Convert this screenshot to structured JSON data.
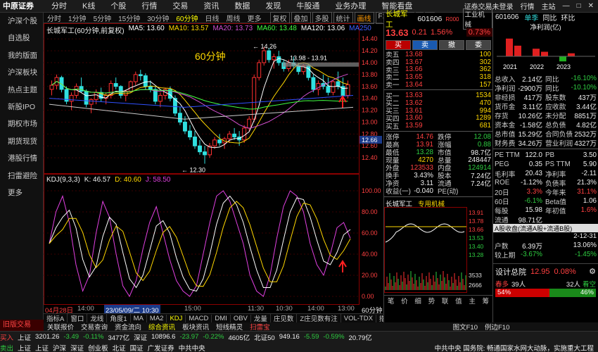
{
  "app": {
    "logo": "中原证券",
    "menu": [
      "分时",
      "K线",
      "个股",
      "行情",
      "交易",
      "资讯",
      "数据",
      "发现",
      "牛股通",
      "业务办理",
      "智能看盘"
    ],
    "topright": [
      "证券交易未登录",
      "行情",
      "主站"
    ],
    "winbtns": [
      "—",
      "□",
      "✕"
    ]
  },
  "sidebar": {
    "items": [
      "沪深个股",
      "自选股",
      "我的版面",
      "沪深板块",
      "热点主题",
      "新股IPO",
      "期权市场",
      "期货现货",
      "港股行情",
      "扫雷避险",
      "更多"
    ],
    "old_trade": "旧版交易"
  },
  "chart_toolbar": {
    "items": [
      "分时",
      "1分钟",
      "5分钟",
      "15分钟",
      "30分钟",
      "60分钟",
      "日线",
      "周线",
      "更多"
    ],
    "active": "60分钟",
    "right_items": [
      "复权",
      "叠加",
      "多股",
      "统计",
      "画线",
      "F10",
      "标记",
      "-",
      "+"
    ]
  },
  "price_chart": {
    "header": "长城军工(60分钟,前复权)",
    "ma": [
      {
        "label": "MA5: 13.60",
        "color": "#ffffff"
      },
      {
        "label": "MA10: 13.57",
        "color": "#ffd700"
      },
      {
        "label": "MA20: 13.73",
        "color": "#d050d0"
      },
      {
        "label": "MA60: 13.48",
        "color": "#40ff40"
      },
      {
        "label": "MA120: 13.06",
        "color": "#ffffff"
      },
      {
        "label": "MA250",
        "color": "#4060ff"
      }
    ],
    "annotation": "60分钟",
    "high_label": "14.26",
    "low_label": "12.30",
    "range_label": "13.98 - 13.91",
    "y_ticks": [
      "14.40",
      "14.20",
      "14.00",
      "13.80",
      "13.60",
      "13.40",
      "13.20",
      "13.00",
      "12.80",
      "12.60",
      "12.40"
    ],
    "last_price": "12.66"
  },
  "kdj": {
    "header": "KDJ(9,3,3)",
    "k": "K: 46.57",
    "d": "D: 40.60",
    "j": "J: 58.50",
    "y_ticks": [
      "100.00",
      "80.00",
      "60.00",
      "40.00",
      "20.00",
      "0.00"
    ]
  },
  "time_axis": {
    "start": "04月28日",
    "labels": [
      "14:00",
      "14:00",
      "15:00",
      "11:30",
      "10:30",
      "14:00",
      "13:00",
      "14:00"
    ],
    "cursor": "23/05/09/二 10:30",
    "period": "60分钟"
  },
  "indicator_tabs": [
    "指标A",
    "窗口",
    "龙线",
    "角度1",
    "MA",
    "MA2",
    "KDJ",
    "MACD",
    "DMI",
    "OBV",
    "龙量",
    "庄见数",
    "Z庄见数有注",
    "VOL-TDX",
    "指标B",
    "模板"
  ],
  "indicator_selected": "KDJ",
  "info_tabs": [
    "关联报价",
    "交易查询",
    "资金流向",
    "综合资讯",
    "板块资讯",
    "短线精灵",
    "扫雷宝"
  ],
  "info_tabs_right": [
    "图文F10",
    "例边F10"
  ],
  "quote": {
    "name": "长城军工",
    "code": "601606",
    "badge": "R000",
    "sector": "工业机械",
    "price": "13.63",
    "change": "0.21",
    "pct": "1.56%",
    "sector_pct": "0.73%",
    "buttons": [
      "买",
      "卖",
      "撤",
      "委"
    ],
    "asks": [
      {
        "label": "卖五",
        "price": "13.68",
        "vol": "100"
      },
      {
        "label": "卖四",
        "price": "13.67",
        "vol": "302"
      },
      {
        "label": "卖三",
        "price": "13.66",
        "vol": "362"
      },
      {
        "label": "卖二",
        "price": "13.65",
        "vol": "318"
      },
      {
        "label": "卖一",
        "price": "13.64",
        "vol": "157"
      }
    ],
    "bids": [
      {
        "label": "买一",
        "price": "13.63",
        "vol": "1534"
      },
      {
        "label": "买二",
        "price": "13.62",
        "vol": "470"
      },
      {
        "label": "买三",
        "price": "13.61",
        "vol": "994"
      },
      {
        "label": "买四",
        "price": "13.60",
        "vol": "1289"
      },
      {
        "label": "买五",
        "price": "13.59",
        "vol": "681"
      }
    ],
    "stats": [
      {
        "a": "涨停",
        "b": "14.76",
        "c": "跌停",
        "d": "12.08",
        "bc": "red",
        "dc": "green"
      },
      {
        "a": "最高",
        "b": "13.91",
        "c": "涨幅",
        "d": "0.88",
        "bc": "red",
        "dc": "green"
      },
      {
        "a": "最低",
        "b": "13.28",
        "c": "市值",
        "d": "98.7亿",
        "bc": "green",
        "dc": "white"
      },
      {
        "a": "现量",
        "b": "4270",
        "c": "总量",
        "d": "248447",
        "bc": "yellow",
        "dc": "white"
      },
      {
        "a": "外盘",
        "b": "123533",
        "c": "内盘",
        "d": "124914",
        "bc": "red",
        "dc": "green"
      },
      {
        "a": "换手",
        "b": "3.43%",
        "c": "股本",
        "d": "7.24亿",
        "bc": "white",
        "dc": "white"
      },
      {
        "a": "净资",
        "b": "3.11",
        "c": "流通",
        "d": "7.24亿",
        "bc": "white",
        "dc": "white"
      },
      {
        "a": "收益(一)",
        "b": "-0.040",
        "c": "PE(动)",
        "d": "",
        "bc": "white",
        "dc": "white"
      }
    ],
    "mini_title": "长城军工",
    "mini_sector": "专用机械",
    "mini_y": [
      "13.91",
      "13.78",
      "13.66",
      "13.53",
      "13.40",
      "13.28"
    ],
    "mini_vol": [
      "3533",
      "2666"
    ],
    "mini_tabs": [
      "笔",
      "价",
      "细",
      "势",
      "联",
      "值",
      "主",
      "筹"
    ]
  },
  "finance": {
    "code": "601606",
    "tabs": [
      "单季",
      "同比",
      "环比"
    ],
    "chart_title": "净利润(亿)",
    "years": [
      "2021",
      "2022",
      "2023"
    ],
    "bars": [
      {
        "year": "2021",
        "value": 2.1
      },
      {
        "year": "2022",
        "value": 0.9
      },
      {
        "year": "2023",
        "value": -0.6
      }
    ],
    "rows": [
      {
        "k": "总收入",
        "v": "2.14亿",
        "k2": "同比",
        "v2": "-16.10%",
        "vc": "white",
        "v2c": "green"
      },
      {
        "k": "净利润",
        "v": "-2900万",
        "k2": "同比",
        "v2": "-10.10%",
        "vc": "white",
        "v2c": "green"
      },
      {
        "k": "非经损",
        "v": "417万",
        "k2": "股东数",
        "v2": "437万",
        "vc": "white",
        "v2c": "white"
      },
      {
        "k": "货币金",
        "v": "3.11亿",
        "k2": "应收款",
        "v2": "3.44亿",
        "vc": "white",
        "v2c": "white"
      },
      {
        "k": "存货",
        "v": "10.26亿",
        "k2": "未分配",
        "v2": "8851万",
        "vc": "white",
        "v2c": "white"
      },
      {
        "k": "资本金",
        "v": "-1.58亿",
        "k2": "总负债",
        "v2": "4.82亿",
        "vc": "white",
        "v2c": "white"
      },
      {
        "k": "总市值",
        "v": "15.29亿",
        "k2": "合同负债",
        "v2": "2532万",
        "vc": "white",
        "v2c": "white"
      },
      {
        "k": "财务费",
        "v": "34.26万",
        "k2": "营业利润",
        "v2": "4327万",
        "vc": "white",
        "v2c": "white"
      }
    ],
    "ratios": [
      {
        "k": "PE TTM",
        "v": "122.0",
        "k2": "PB",
        "v2": "3.50",
        "vc": "white",
        "v2c": "white"
      },
      {
        "k": "PEG",
        "v": "0.35",
        "k2": "PS TTM",
        "v2": "5.90",
        "vc": "white",
        "v2c": "white"
      },
      {
        "k": "毛利率",
        "v": "20.43",
        "k2": "净利率",
        "v2": "-2.11",
        "vc": "white",
        "v2c": "white"
      },
      {
        "k": "ROE",
        "v": "-1.12%",
        "k2": "负债率",
        "v2": "21.3%",
        "vc": "white",
        "v2c": "white"
      },
      {
        "k": "20日",
        "v": "3.3%",
        "k2": "今年来",
        "v2": "31.1%",
        "vc": "red",
        "v2c": "red"
      },
      {
        "k": "60日",
        "v": "-6.1%",
        "k2": "Beta值",
        "v2": "1.06",
        "vc": "green",
        "v2c": "white"
      },
      {
        "k": "每股",
        "v": "15.98",
        "k2": "年初值",
        "v2": "1.6%",
        "vc": "white",
        "v2c": "red"
      },
      {
        "k": "流通",
        "v": "98.71亿",
        "k2": "",
        "v2": "",
        "vc": "white",
        "v2c": "white"
      }
    ],
    "tooltip": "A股收盘(流通A股+流通B股)",
    "date": "2-12-31",
    "hu": "户数",
    "hu_v": "6.39万",
    "hu_pct": "13.06%",
    "rise": "较上期",
    "rise_v": "-3.67%",
    "rise_v2": "-1.45%",
    "design_label": "设计总院",
    "design_price": "12.95",
    "design_pct": "0.08%",
    "spring_l": "春多",
    "spring_count": "39人",
    "spring_r": "32人",
    "spring_rlabel": "看空",
    "bull_pct": "54%",
    "bear_pct": "46%"
  },
  "status": {
    "row1": [
      "买入",
      "上证",
      "3201.26",
      "-3.49",
      "-0.11%",
      "3477亿",
      "深证",
      "10896.6",
      "-23.97",
      "-0.22%",
      "4605亿",
      "北证50",
      "949.16",
      "-5.59",
      "-0.59%",
      "20.79亿"
    ],
    "row2": [
      "卖出",
      "上证",
      "上证",
      "沪深",
      "深证",
      "创业板",
      "北证",
      "国证",
      "广发证券",
      "中共中央"
    ],
    "news": "中共中央 国务院: 畅通国家水网大动脉，实施重大工程"
  }
}
